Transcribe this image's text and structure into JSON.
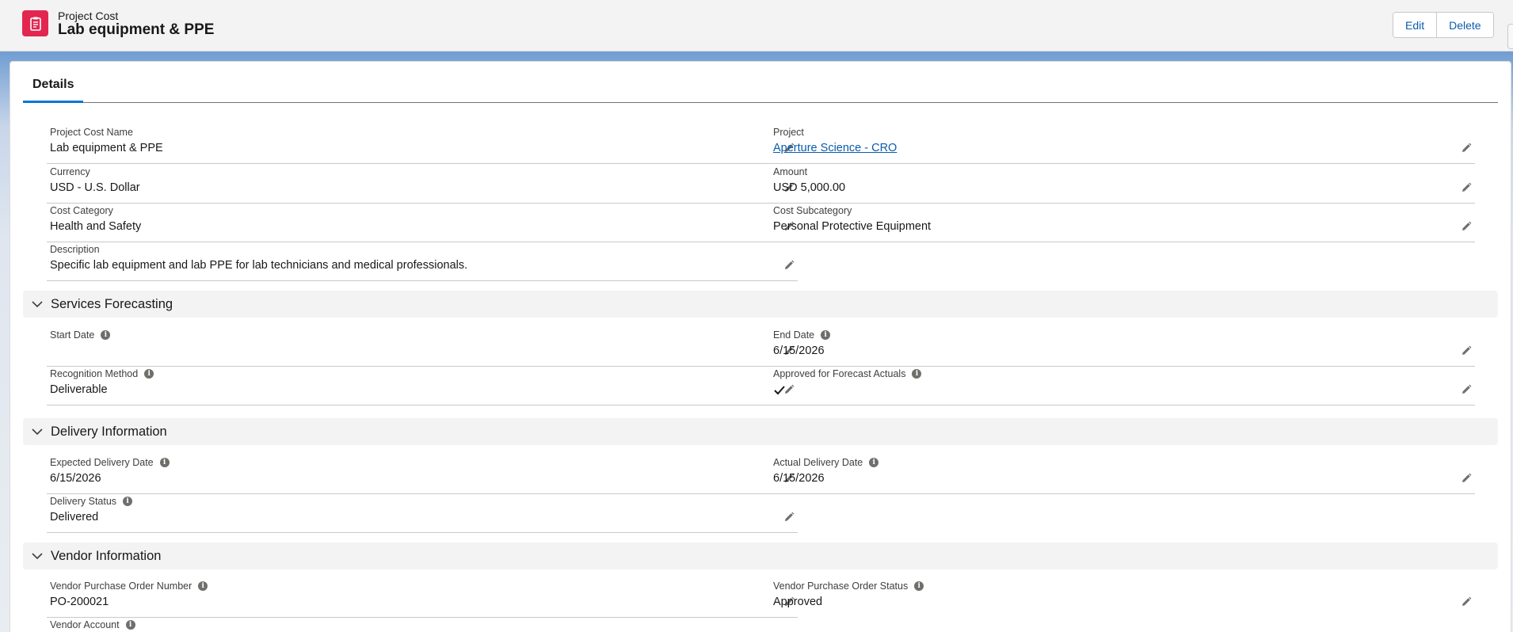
{
  "header": {
    "object_type": "Project Cost",
    "record_name": "Lab equipment & PPE",
    "edit_label": "Edit",
    "delete_label": "Delete"
  },
  "tabs": [
    {
      "label": "Details"
    }
  ],
  "fields": {
    "project_cost_name": {
      "label": "Project Cost Name",
      "value": "Lab equipment & PPE"
    },
    "project": {
      "label": "Project",
      "value": "Aperture Science - CRO"
    },
    "currency": {
      "label": "Currency",
      "value": "USD - U.S. Dollar"
    },
    "amount": {
      "label": "Amount",
      "value": "USD 5,000.00"
    },
    "cost_category": {
      "label": "Cost Category",
      "value": "Health and Safety"
    },
    "cost_subcategory": {
      "label": "Cost Subcategory",
      "value": "Personal Protective Equipment"
    },
    "description": {
      "label": "Description",
      "value": "Specific lab equipment and lab PPE for lab technicians and medical professionals."
    }
  },
  "services_forecasting": {
    "title": "Services Forecasting",
    "start_date": {
      "label": "Start Date",
      "value": ""
    },
    "end_date": {
      "label": "End Date",
      "value": "6/15/2026"
    },
    "recognition_method": {
      "label": "Recognition Method",
      "value": "Deliverable"
    },
    "approved_for_forecast_actuals": {
      "label": "Approved for Forecast Actuals",
      "checked": true
    }
  },
  "delivery_information": {
    "title": "Delivery Information",
    "expected_delivery_date": {
      "label": "Expected Delivery Date",
      "value": "6/15/2026"
    },
    "actual_delivery_date": {
      "label": "Actual Delivery Date",
      "value": "6/15/2026"
    },
    "delivery_status": {
      "label": "Delivery Status",
      "value": "Delivered"
    }
  },
  "vendor_information": {
    "title": "Vendor Information",
    "vendor_po_number": {
      "label": "Vendor Purchase Order Number",
      "value": "PO-200021"
    },
    "vendor_po_status": {
      "label": "Vendor Purchase Order Status",
      "value": "Approved"
    },
    "vendor_account": {
      "label": "Vendor Account",
      "value": ""
    }
  },
  "icons": {
    "object": "project-cost-icon",
    "edit": "pencil-icon",
    "info": "info-icon",
    "collapse": "chevron-down-icon",
    "checked": "checkmark-icon"
  },
  "colors": {
    "object_icon": "#e3264f",
    "link": "#0b5cab",
    "tab_active": "#0176d3"
  }
}
